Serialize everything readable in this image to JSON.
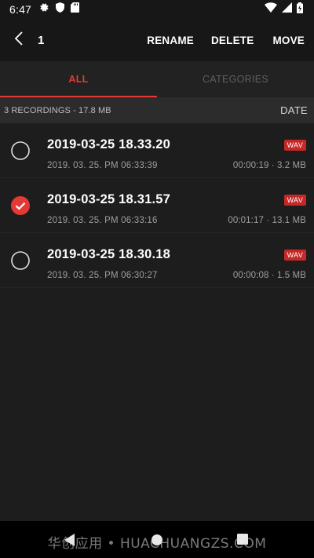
{
  "status_bar": {
    "time": "6:47"
  },
  "app_bar": {
    "selected_count": "1",
    "actions": {
      "rename": "RENAME",
      "delete": "DELETE",
      "move": "MOVE"
    }
  },
  "tabs": [
    {
      "label": "ALL",
      "active": true
    },
    {
      "label": "CATEGORIES",
      "active": false
    }
  ],
  "summary": {
    "text": "3 RECORDINGS - 17.8 MB",
    "sort_label": "DATE"
  },
  "recordings": [
    {
      "title": "2019-03-25 18.33.20",
      "date": "2019. 03. 25. PM 06:33:39",
      "format": "WAV",
      "meta": "00:00:19 · 3.2 MB",
      "selected": false
    },
    {
      "title": "2019-03-25 18.31.57",
      "date": "2019. 03. 25. PM 06:33:16",
      "format": "WAV",
      "meta": "00:01:17 · 13.1 MB",
      "selected": true
    },
    {
      "title": "2019-03-25 18.30.18",
      "date": "2019. 03. 25. PM 06:30:27",
      "format": "WAV",
      "meta": "00:00:08 · 1.5 MB",
      "selected": false
    }
  ],
  "watermark": "华创应用 • HUACHUANGZS.COM",
  "colors": {
    "accent": "#e53935",
    "badge": "#c62828",
    "background": "#1d1d1d"
  }
}
